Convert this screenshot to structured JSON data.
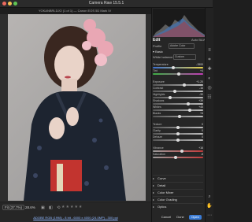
{
  "window": {
    "title": "Camera Raw 15.5.1"
  },
  "infobar": {
    "text": "YOKANBRLDJO (1 of 1)  —  Canon EOS 5D Mark IV"
  },
  "preview": {
    "subject": "woman in kimono with pink flower hairpiece"
  },
  "bottom": {
    "fit_label": "Fit (37.7%)",
    "zoom": "28.6%",
    "file_link": "ADOBE RGB (1998) - 8 bit - 6000 x 4000 (24.0MP) - 300 ppi"
  },
  "panel": {
    "edit_label": "Edit",
    "auto_label": "Auto",
    "bw_label": "B&W",
    "profile_label": "Profile",
    "profile_value": "Adobe Color",
    "basic_label": "Basic",
    "white_balance_label": "White balance",
    "white_balance_value": "Custom",
    "sliders": [
      {
        "label": "Temperature",
        "value": "-1500",
        "fraction": 0.4,
        "track": "temp"
      },
      {
        "label": "Tint",
        "value": "+4",
        "fraction": 0.52,
        "track": "tint"
      },
      {
        "label": "Exposure",
        "value": "+1.20",
        "fraction": 0.62,
        "track": "gray"
      },
      {
        "label": "Contrast",
        "value": "-16",
        "fraction": 0.44,
        "track": "gray"
      },
      {
        "label": "Highlights",
        "value": "-30",
        "fraction": 0.35,
        "track": "gray"
      },
      {
        "label": "Shadows",
        "value": "+39",
        "fraction": 0.7,
        "track": "gray"
      },
      {
        "label": "Whites",
        "value": "+45",
        "fraction": 0.73,
        "track": "gray"
      },
      {
        "label": "Blacks",
        "value": "+6",
        "fraction": 0.53,
        "track": "gray"
      },
      {
        "label": "Texture",
        "value": "0",
        "fraction": 0.5,
        "track": "gray"
      },
      {
        "label": "Clarity",
        "value": "0",
        "fraction": 0.5,
        "track": "gray"
      },
      {
        "label": "Dehaze",
        "value": "0",
        "fraction": 0.5,
        "track": "gray"
      },
      {
        "label": "Vibrance",
        "value": "+16",
        "fraction": 0.58,
        "track": "vib"
      },
      {
        "label": "Saturation",
        "value": "-8",
        "fraction": 0.46,
        "track": "sat"
      }
    ],
    "collapsed_sections": [
      "Curve",
      "Detail",
      "Color Mixer",
      "Color Grading",
      "Optics"
    ],
    "cancel_label": "Cancel",
    "done_label": "Done",
    "open_label": "Open"
  },
  "colors": {
    "accent": "#3a7bd5",
    "panel_bg": "#262626",
    "kimono": "#1d2430",
    "obi_red": "#c2342f",
    "flower": "#e9a7b4"
  }
}
